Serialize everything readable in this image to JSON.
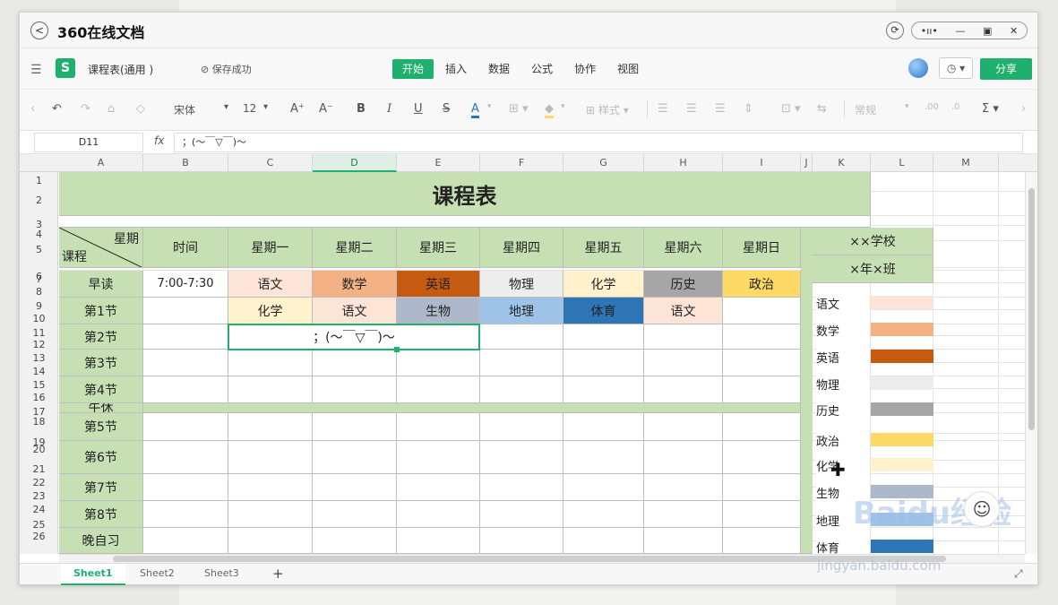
{
  "window": {
    "title": "360在线文档"
  },
  "header": {
    "doc_name": "课程表(通用 )",
    "save_status": "保存成功",
    "share": "分享",
    "tabs": [
      {
        "label": "开始",
        "active": true
      },
      {
        "label": "插入"
      },
      {
        "label": "数据"
      },
      {
        "label": "公式"
      },
      {
        "label": "协作"
      },
      {
        "label": "视图"
      }
    ]
  },
  "toolbar": {
    "font": "宋体",
    "size": "12",
    "font_increase": "A⁺",
    "font_decrease": "A⁻",
    "bold": "B",
    "italic": "I",
    "underline": "U",
    "strike": "S",
    "font_color_label": "A",
    "style_label": "样式",
    "number_format": "常规"
  },
  "formula_bar": {
    "cell": "D11",
    "fx": "fx",
    "content": "；(～￣▽￣)～"
  },
  "columns": [
    "A",
    "B",
    "C",
    "D",
    "E",
    "F",
    "G",
    "H",
    "I",
    "J",
    "K",
    "L",
    "M"
  ],
  "selected_column": "D",
  "rows": [
    "1",
    "2",
    "3",
    "4",
    "5",
    "6",
    "7",
    "8",
    "9",
    "10",
    "11",
    "12",
    "13",
    "14",
    "15",
    "16",
    "17",
    "18",
    "19",
    "20",
    "21",
    "22",
    "23",
    "24",
    "25",
    "26"
  ],
  "sheet": {
    "title": "课程表",
    "corner_top": "星期",
    "corner_bottom": "课程",
    "time_header": "时间",
    "days": [
      "星期一",
      "星期二",
      "星期三",
      "星期四",
      "星期五",
      "星期六",
      "星期日"
    ],
    "periods": [
      "早读",
      "第1节",
      "第2节",
      "第3节",
      "第4节",
      "午休",
      "第5节",
      "第6节",
      "第7节",
      "第8节",
      "晚自习"
    ],
    "zaodu_time": "7:00-7:30",
    "zaodu": [
      "语文",
      "数学",
      "英语",
      "物理",
      "化学",
      "历史",
      "政治"
    ],
    "p1": [
      "化学",
      "语文",
      "生物",
      "地理",
      "体育",
      "语文",
      ""
    ],
    "selected_text": "；(～￣▽￣)～",
    "school": "××学校",
    "klass": "×年×班",
    "legend": [
      {
        "name": "语文",
        "color": "#fce4d6"
      },
      {
        "name": "数学",
        "color": "#f4b183"
      },
      {
        "name": "英语",
        "color": "#c55a11"
      },
      {
        "name": "物理",
        "color": "#ededed"
      },
      {
        "name": "历史",
        "color": "#a6a6a6"
      },
      {
        "name": "政治",
        "color": "#ffd966"
      },
      {
        "name": "化学",
        "color": "#fff2cc"
      },
      {
        "name": "生物",
        "color": "#adb9ca"
      },
      {
        "name": "地理",
        "color": "#9dc3e6"
      },
      {
        "name": "体育",
        "color": "#2e75b6"
      }
    ]
  },
  "colors": {
    "accent": "#1fb06d",
    "header_green": "#c6e0b4"
  },
  "sheet_tabs": [
    {
      "label": "Sheet1",
      "active": true
    },
    {
      "label": "Sheet2"
    },
    {
      "label": "Sheet3"
    }
  ],
  "add_sheet": "+",
  "watermark": {
    "logo": "Baidu经验",
    "url": "jingyan.baidu.com"
  }
}
